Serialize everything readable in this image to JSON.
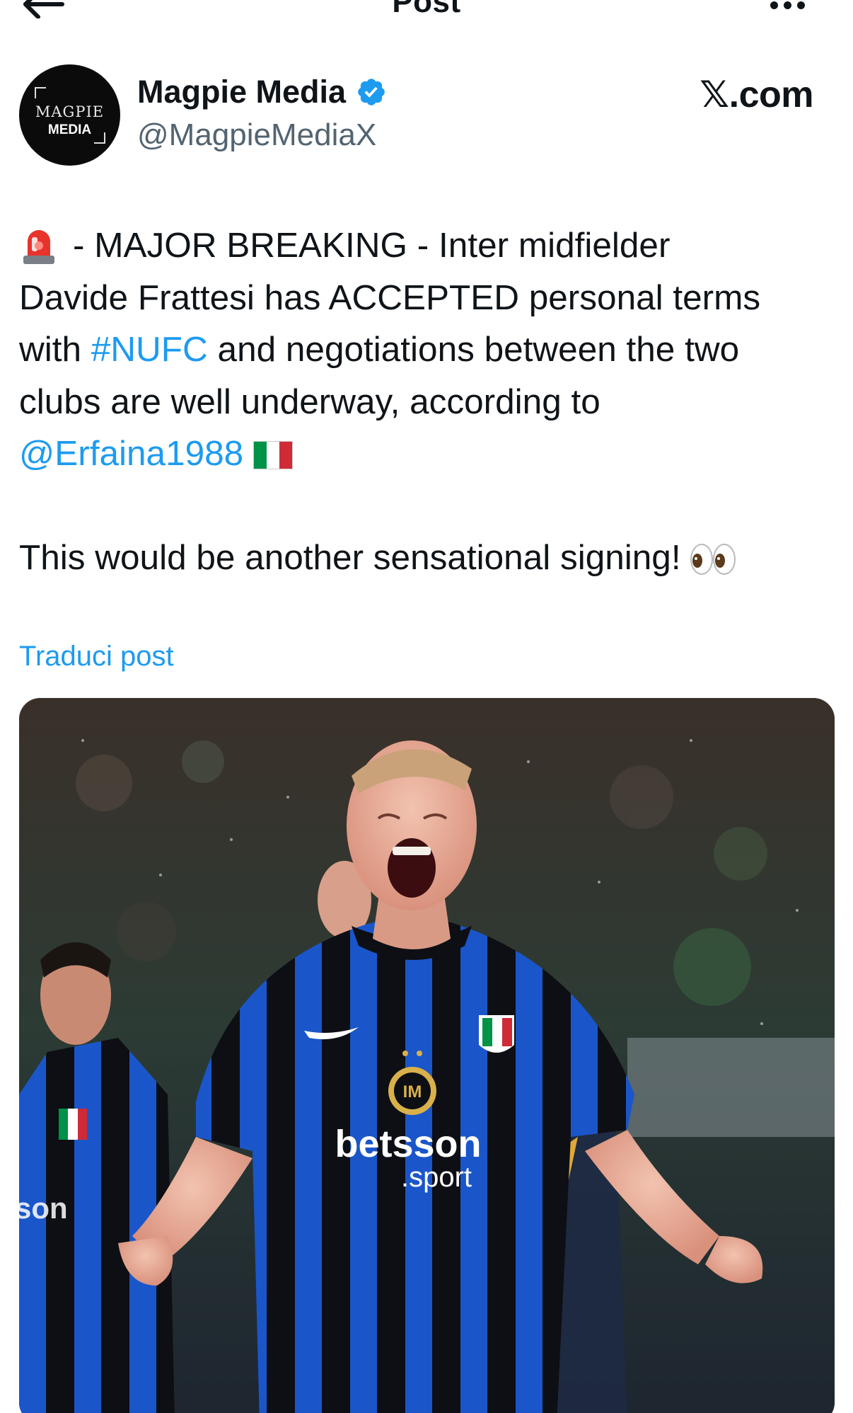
{
  "nav": {
    "title": "Post"
  },
  "author": {
    "avatar_line1": "MAGPIE",
    "avatar_line2": "MEDIA",
    "display_name": "Magpie Media",
    "handle": "@MagpieMediaX",
    "verified": true
  },
  "source_label": "𝕏.com",
  "tweet": {
    "line1": "- MAJOR BREAKING - Inter midfielder",
    "line2": "Davide Frattesi has ACCEPTED personal terms",
    "line3_a": "with ",
    "line3_hashtag": "#NUFC",
    "line3_b": " and negotiations between the two",
    "line4": "clubs are well underway, according to",
    "mention": "@Erfaina1988",
    "line6": "This would be another sensational signing!"
  },
  "translate_label": "Traduci post",
  "media": {
    "sponsor_main": "betsson",
    "sponsor_sub": ".sport",
    "side_text": "son",
    "colors": {
      "inter_blue": "#1a56c9",
      "inter_black": "#0d0f14"
    }
  },
  "icons": {
    "back": "arrow-left-icon",
    "more": "more-dots-icon",
    "verified": "verified-badge-icon",
    "siren": "police-light-emoji",
    "flag": "italy-flag-emoji",
    "eyes": "eyes-emoji"
  },
  "colors": {
    "link": "#1d9bf0",
    "secondary_text": "#536471",
    "primary_text": "#0f1419"
  }
}
